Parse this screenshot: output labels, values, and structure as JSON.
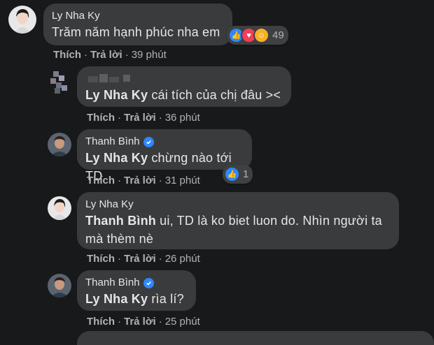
{
  "comments": [
    {
      "author": "Ly Nha Ky",
      "mention": "",
      "text": "Trăm năm hạnh phúc nha em",
      "reactions_count": "49",
      "actions": {
        "like": "Thích",
        "reply": "Trả lời",
        "time": "39 phút"
      }
    },
    {
      "author": "",
      "mention": "Ly Nha Ky",
      "text": " cái tích của chị đâu ><",
      "actions": {
        "like": "Thích",
        "reply": "Trả lời",
        "time": "36 phút"
      }
    },
    {
      "author": "Thanh Bình",
      "mention": "Ly Nha Ky",
      "text": " chừng nào tới TD",
      "reactions_count": "1",
      "actions": {
        "like": "Thích",
        "reply": "Trả lời",
        "time": "31 phút"
      }
    },
    {
      "author": "Ly Nha Ky",
      "mention": "Thanh Bình",
      "text": " ui, TD là ko biet luon do. Nhìn người ta mà thèm nè",
      "actions": {
        "like": "Thích",
        "reply": "Trả lời",
        "time": "26 phút"
      }
    },
    {
      "author": "Thanh Bình",
      "mention": "Ly Nha Ky",
      "text": " rìa lí?",
      "actions": {
        "like": "Thích",
        "reply": "Trả lời",
        "time": "25 phút"
      }
    }
  ],
  "separator": "·",
  "colors": {
    "background": "#18191a",
    "bubble": "#3a3b3c",
    "verified": "#2d88ff",
    "like": "#2d88ff",
    "love": "#f33e58",
    "care": "#f7b125"
  }
}
